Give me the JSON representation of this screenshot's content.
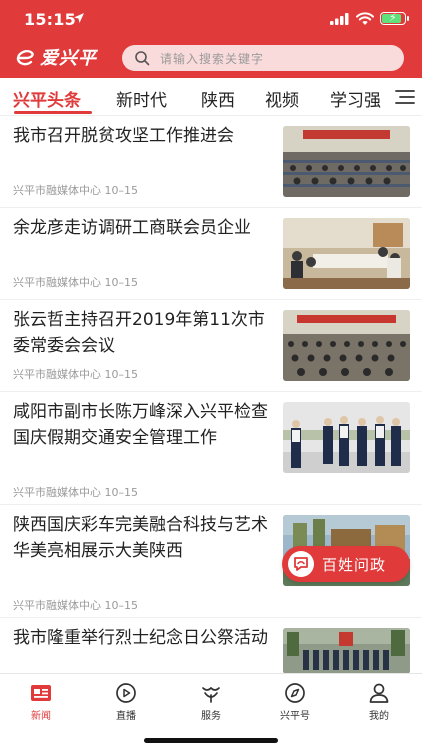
{
  "status": {
    "time": "15:15"
  },
  "app": {
    "name": "爱兴平",
    "accent": "#e03a3a"
  },
  "search": {
    "placeholder": "请输入搜索关键字"
  },
  "tabs": [
    {
      "label": "兴平头条",
      "active": true
    },
    {
      "label": "新时代"
    },
    {
      "label": "陕西"
    },
    {
      "label": "视频"
    },
    {
      "label": "学习强"
    }
  ],
  "news": [
    {
      "title": "我市召开脱贫攻坚工作推进会",
      "source": "兴平市融媒体中心",
      "date": "10–15",
      "thumb": "meeting-hall-photo"
    },
    {
      "title": "余龙彦走访调研工商联会员企业",
      "source": "兴平市融媒体中心",
      "date": "10–15",
      "thumb": "office-meeting-photo"
    },
    {
      "title": "张云哲主持召开2019年第11次市委常委会会议",
      "source": "兴平市融媒体中心",
      "date": "10–15",
      "thumb": "committee-meeting-photo"
    },
    {
      "title": "咸阳市副市长陈万峰深入兴平检查国庆假期交通安全管理工作",
      "source": "兴平市融媒体中心",
      "date": "10–15",
      "thumb": "traffic-inspection-photo"
    },
    {
      "title": "陕西国庆彩车完美融合科技与艺术华美亮相展示大美陕西",
      "source": "兴平市融媒体中心",
      "date": "10–15",
      "thumb": "parade-float-photo"
    },
    {
      "title": "我市隆重举行烈士纪念日公祭活动",
      "source": "",
      "date": "",
      "thumb": "memorial-ceremony-photo"
    }
  ],
  "float_button": {
    "label": "百姓问政"
  },
  "bottom_nav": [
    {
      "label": "新闻",
      "icon": "news-icon",
      "active": true
    },
    {
      "label": "直播",
      "icon": "live-play-icon"
    },
    {
      "label": "服务",
      "icon": "service-icon"
    },
    {
      "label": "兴平号",
      "icon": "compass-icon"
    },
    {
      "label": "我的",
      "icon": "user-icon"
    }
  ]
}
